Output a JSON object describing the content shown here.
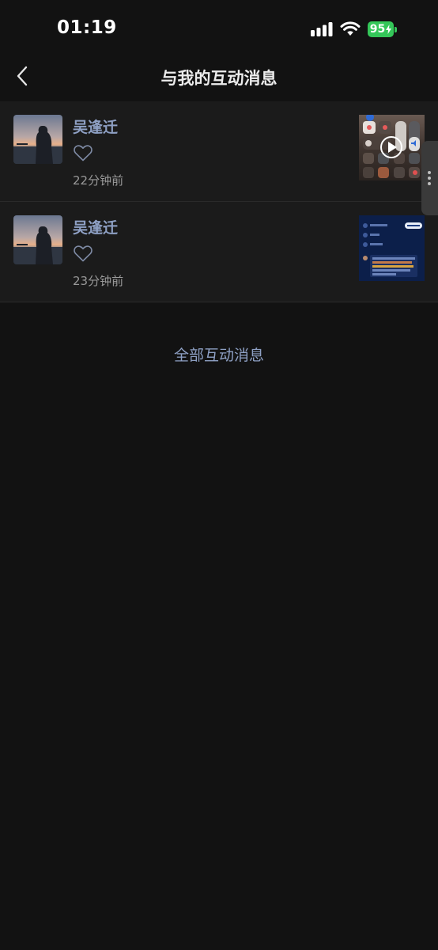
{
  "status_bar": {
    "time": "01:19",
    "battery": "95"
  },
  "header": {
    "title": "与我的互动消息"
  },
  "messages": [
    {
      "user": "吴逢迁",
      "time": "22分钟前"
    },
    {
      "user": "吴逢迁",
      "time": "23分钟前"
    }
  ],
  "footer": {
    "all_link": "全部互动消息"
  },
  "colors": {
    "background": "#121212",
    "row_background": "#1b1b1b",
    "accent": "#8ea0c4",
    "battery": "#34c759"
  }
}
